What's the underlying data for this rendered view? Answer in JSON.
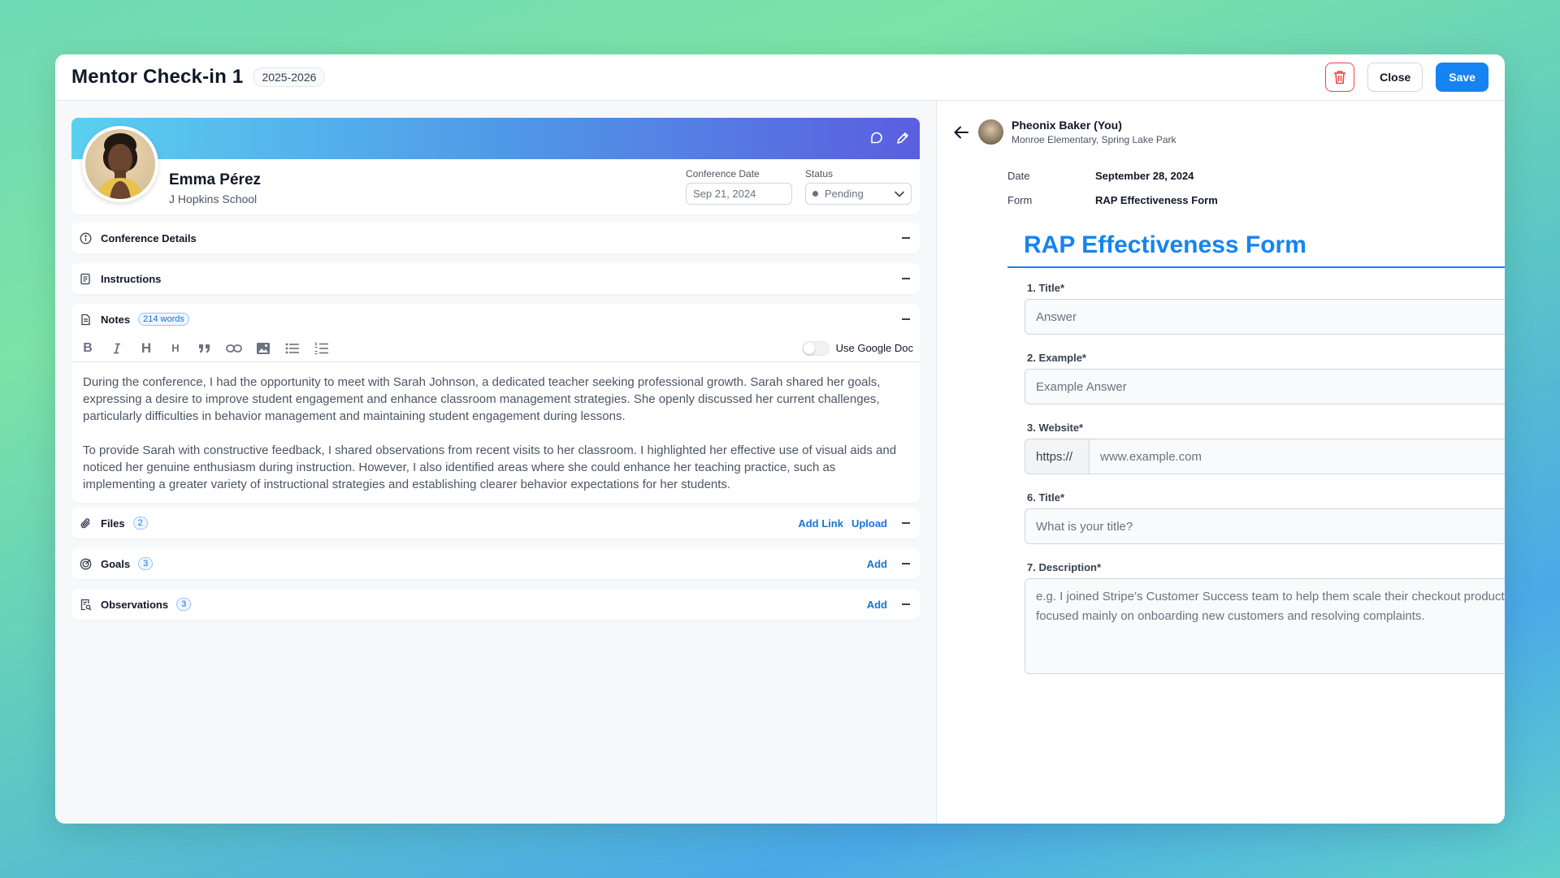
{
  "header": {
    "title": "Mentor Check-in 1",
    "year_badge": "2025-2026",
    "close_label": "Close",
    "save_label": "Save"
  },
  "profile": {
    "name": "Emma Pérez",
    "school": "J Hopkins School",
    "conference_date_label": "Conference Date",
    "conference_date_value": "Sep 21, 2024",
    "status_label": "Status",
    "status_value": "Pending"
  },
  "sections": {
    "conference_details": "Conference Details",
    "instructions": "Instructions",
    "notes": {
      "title": "Notes",
      "word_count": "214 words",
      "use_google_doc": "Use Google Doc",
      "paragraphs": [
        "During the conference, I had the opportunity to meet with Sarah Johnson, a dedicated teacher seeking professional growth. Sarah shared her goals, expressing a desire to improve student engagement and enhance classroom management strategies. She openly discussed her current challenges, particularly difficulties in behavior management and maintaining student engagement during lessons.",
        "To provide Sarah with constructive feedback, I shared observations from recent visits to her classroom. I highlighted her effective use of visual aids and noticed her genuine enthusiasm during instruction. However, I also identified areas where she could enhance her teaching practice, such as implementing a greater variety of instructional strategies and establishing clearer behavior expectations for her students."
      ],
      "toolbar": [
        "bold-icon",
        "italic-icon",
        "heading-icon",
        "heading-small-icon",
        "quote-icon",
        "link-icon",
        "image-icon",
        "bullet-list-icon",
        "numbered-list-icon"
      ]
    },
    "files": {
      "title": "Files",
      "count": "2",
      "add_link": "Add Link",
      "upload": "Upload"
    },
    "goals": {
      "title": "Goals",
      "count": "3",
      "add": "Add"
    },
    "observations": {
      "title": "Observations",
      "count": "3",
      "add": "Add"
    }
  },
  "right": {
    "author_name": "Pheonix Baker (You)",
    "author_sub": "Monroe Elementary, Spring Lake Park",
    "date_label": "Date",
    "date_value": "September 28, 2024",
    "form_label": "Form",
    "form_value": "RAP Effectiveness Form",
    "form_heading": "RAP Effectiveness Form",
    "questions": [
      {
        "label": "1. Title*",
        "placeholder": "Answer"
      },
      {
        "label": "2. Example*",
        "placeholder": "Example Answer"
      },
      {
        "label": "3. Website*",
        "prefix": "https://",
        "placeholder": "www.example.com"
      },
      {
        "label": "6. Title*",
        "placeholder": "What is your title?"
      },
      {
        "label": "7. Description*",
        "placeholder": "e.g. I joined Stripe’s Customer Success team to help them scale their checkout product. I focused mainly on onboarding new customers and resolving complaints."
      }
    ]
  },
  "colors": {
    "accent": "#1683f3",
    "danger": "#ef4444",
    "link": "#1576d6"
  }
}
